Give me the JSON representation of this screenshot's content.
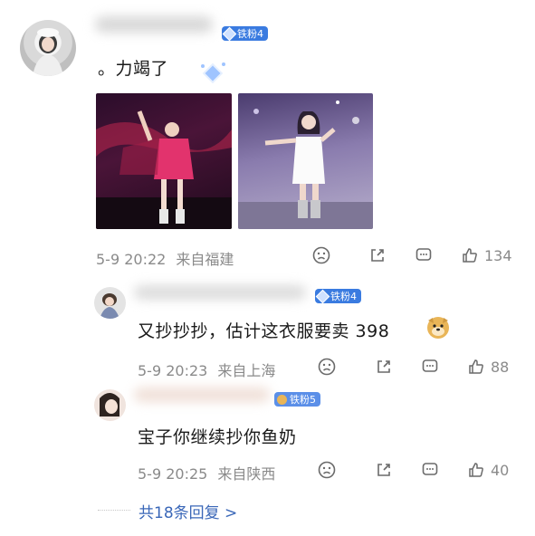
{
  "comment": {
    "badge": "铁粉4",
    "text": "。力竭了",
    "time": "5-9 20:22",
    "location": "来自福建",
    "likes": "134"
  },
  "replies": [
    {
      "badge": "铁粉4",
      "text": "又抄抄抄，估计这衣服要卖 398",
      "time": "5-9 20:23",
      "location": "来自上海",
      "likes": "88"
    },
    {
      "badge": "铁粉5",
      "text": "宝子你继续抄你鱼奶",
      "time": "5-9 20:25",
      "location": "来自陕西",
      "likes": "40"
    }
  ],
  "more_replies": "共18条回复 >",
  "icons": {
    "react": "smile-face-icon",
    "share": "share-icon",
    "comment": "comment-icon",
    "like": "thumbs-up-icon"
  },
  "colors": {
    "badge": "#3a7be0",
    "link": "#3a67b8",
    "meta": "#8a8a8a"
  }
}
